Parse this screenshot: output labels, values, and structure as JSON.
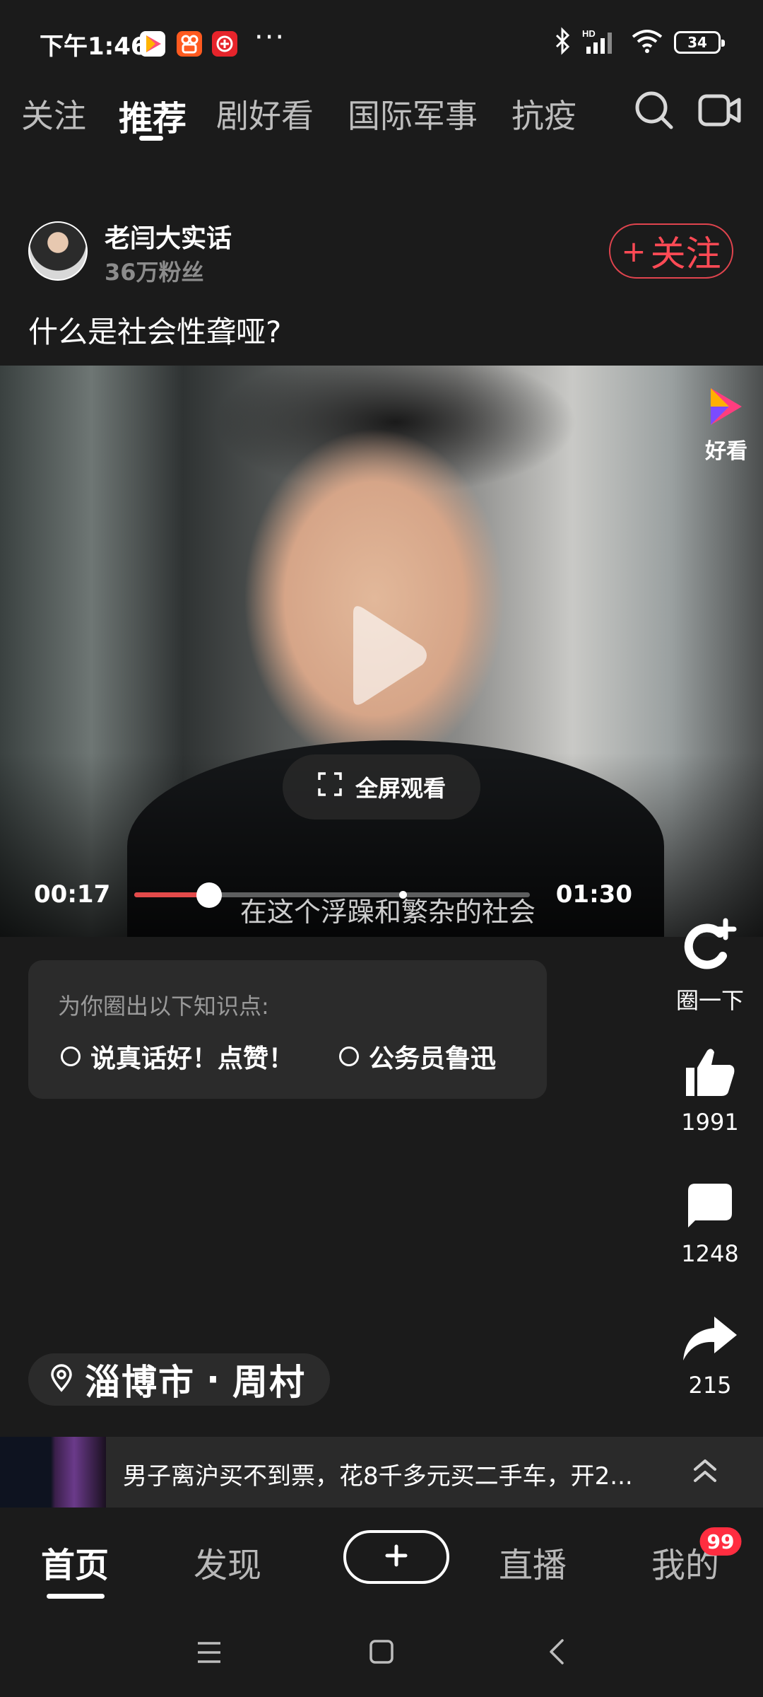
{
  "status_bar": {
    "time": "下午1:46",
    "dots": "···",
    "battery": "34",
    "network": "HD"
  },
  "top_tabs": [
    {
      "label": "关注",
      "active": false
    },
    {
      "label": "推荐",
      "active": true
    },
    {
      "label": "剧好看",
      "active": false
    },
    {
      "label": "国际军事",
      "active": false
    },
    {
      "label": "抗疫",
      "active": false
    }
  ],
  "post": {
    "author": "老闫大实话",
    "fans": "36万粉丝",
    "follow_label": "关注",
    "title": "什么是社会性聋哑?"
  },
  "video": {
    "watermark": "好看",
    "fullscreen_label": "全屏观看",
    "current_time": "00:17",
    "total_time": "01:30",
    "progress_fraction": 0.19,
    "subtitle": "在这个浮躁和繁杂的社会"
  },
  "knowledge": {
    "title": "为你圈出以下知识点:",
    "points": [
      "说真话好！点赞！",
      "公务员鲁迅"
    ]
  },
  "actions": {
    "circle_label": "圈一下",
    "likes": "1991",
    "comments": "1248",
    "shares": "215"
  },
  "location": {
    "city": "淄博市",
    "sep": "·",
    "area": "周村"
  },
  "news": {
    "text": "男子离沪买不到票，花8千多元买二手车，开2..."
  },
  "bottom_nav": {
    "home": "首页",
    "discover": "发现",
    "live": "直播",
    "me": "我的",
    "badge": "99"
  },
  "colors": {
    "background": "#1b1b1b",
    "accent_red": "#ff4a55",
    "progress_red": "#e34a4a"
  }
}
